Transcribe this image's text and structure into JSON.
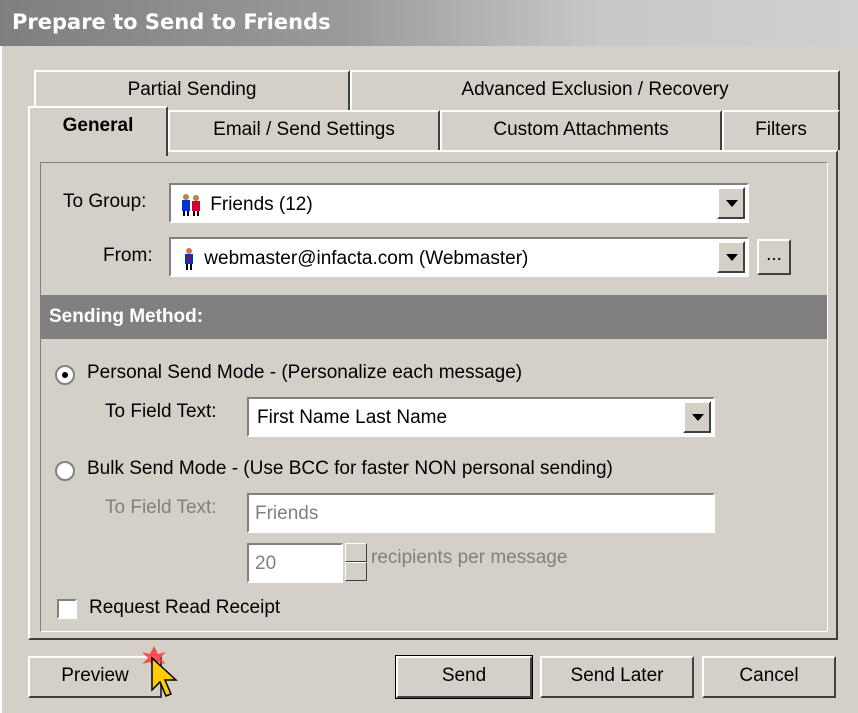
{
  "window": {
    "title": "Prepare to Send to Friends"
  },
  "tabs": {
    "back_row": [
      {
        "label": "Partial Sending"
      },
      {
        "label": "Advanced Exclusion / Recovery"
      }
    ],
    "front_row": [
      {
        "label": "General",
        "active": true
      },
      {
        "label": "Email / Send Settings"
      },
      {
        "label": "Custom Attachments"
      },
      {
        "label": "Filters"
      }
    ]
  },
  "general": {
    "to_group_label": "To Group:",
    "to_group_value": "Friends (12)",
    "from_label": "From:",
    "from_value": "webmaster@infacta.com  (Webmaster)",
    "browse_label": "...",
    "sending_method_header": "Sending Method:",
    "personal_mode_label": "Personal Send Mode - (Personalize each message)",
    "personal_mode_selected": true,
    "personal_to_field_label": "To Field Text:",
    "personal_to_field_value": "First Name Last Name",
    "bulk_mode_label": "Bulk Send Mode - (Use BCC for faster NON personal sending)",
    "bulk_mode_selected": false,
    "bulk_to_field_label": "To Field Text:",
    "bulk_to_field_value": "Friends",
    "recipients_value": "20",
    "recipients_label": "recipients per message",
    "read_receipt_label": "Request Read Receipt",
    "read_receipt_checked": false
  },
  "buttons": {
    "preview": "Preview",
    "send": "Send",
    "send_later": "Send Later",
    "cancel": "Cancel"
  },
  "icons": {
    "group": "group-people-icon",
    "person": "person-icon",
    "cursor": "arrow-cursor-icon"
  },
  "colors": {
    "titlebar": "#808080",
    "section_header": "#808080",
    "face": "#d4d0c8"
  }
}
